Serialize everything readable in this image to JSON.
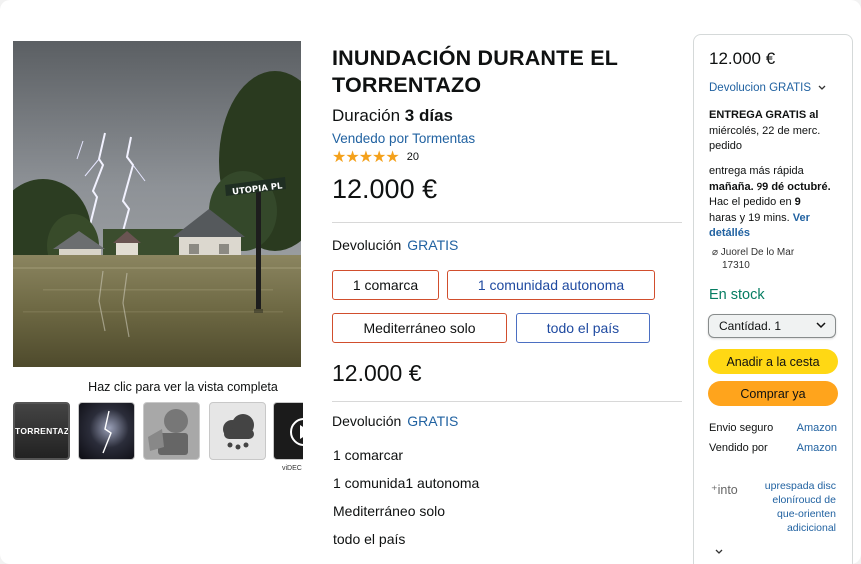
{
  "media": {
    "street_sign": "UTOPIA PL",
    "full_view_text": "Haz clic para ver la vista completa",
    "thumb1_text": "TORRENTAZO",
    "video_label": "viDEC"
  },
  "product": {
    "title": "INUNDACIÓN DURANTE EL TORRENTAZO",
    "duration_label": "Duración",
    "duration_value": "3 días",
    "seller": "Vendedo por Tormentas",
    "stars": "★★★★★",
    "rating_count": "20",
    "price": "12.000 €",
    "return_label": "Devolución",
    "return_free": "GRATIS",
    "options": [
      "1 comarca",
      "1 comunidad autonoma",
      "Mediterráneo solo",
      "todo el país"
    ],
    "price2": "12.000 €",
    "return_label2": "Devolución",
    "return_free2": "GRATIS",
    "list_options": [
      "1 comarcar",
      "1 comunida1 autonoma",
      "Mediterráneo solo",
      "todo el país"
    ]
  },
  "buybox": {
    "price": "12.000 €",
    "return_text": "Devolucion GRATIS",
    "delivery_bold": "ENTREGA GRATIS al",
    "delivery_rest": "miércolés, 22 de merc. pedido",
    "fast_1": "entrega más rápida",
    "fast_bold": "mañaña. ୨9 dé octubré.",
    "fast_2": "Hac el pedido en",
    "fast_bold2": "9",
    "fast_3": "haras y 19 mins.",
    "fast_link": "Ver detállés",
    "location_line1": "⌀ Juorel De lo Mar",
    "location_line2": "17310",
    "stock": "En stock",
    "qty": "Cantídad. 1",
    "cart_btn": "Anadir a la cesta",
    "buy_btn": "Comprar ya",
    "ship_label": "Envio seguro",
    "ship_value": "Amazon",
    "sold_label": "Vendido por",
    "sold_value": "Amazon",
    "info_label": "⁺into",
    "extra_text": "uprespada disc elonírоucd de que-orienten adicicional"
  }
}
